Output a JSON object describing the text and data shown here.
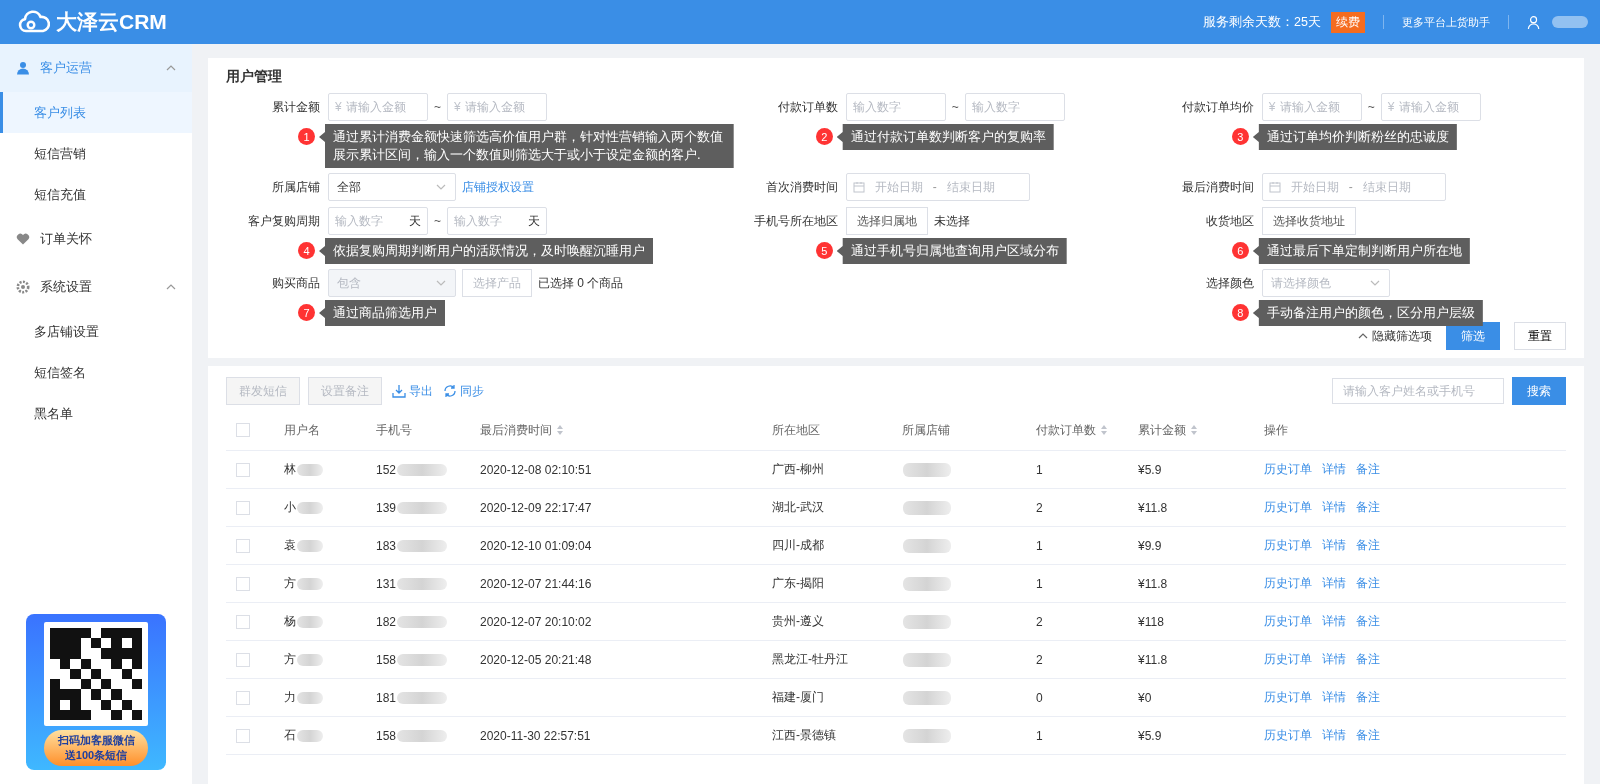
{
  "header": {
    "brand": "大泽云CRM",
    "service_days": "服务剩余天数：25天",
    "renew_badge": "续费",
    "more_link": "更多平台上货助手"
  },
  "sidebar": {
    "groups": [
      {
        "label": "客户运营",
        "selected": true,
        "expanded": true,
        "children": [
          {
            "label": "客户列表",
            "selected": true
          },
          {
            "label": "短信营销",
            "selected": false
          },
          {
            "label": "短信充值",
            "selected": false
          }
        ]
      },
      {
        "label": "订单关怀",
        "selected": false
      },
      {
        "label": "系统设置",
        "selected": false,
        "expanded": true,
        "children": [
          {
            "label": "多店铺设置",
            "selected": false
          },
          {
            "label": "短信签名",
            "selected": false
          },
          {
            "label": "黑名单",
            "selected": false
          }
        ]
      }
    ],
    "promo": {
      "lines": [
        "扫码加客服微信",
        "送**100**条短信"
      ]
    }
  },
  "filters": {
    "title": "用户管理",
    "rows": [
      {
        "cells": [
          {
            "kind": "money_range",
            "label": "累计金额",
            "prefix": "¥",
            "placeholders": [
              "请输入金额",
              "请输入金额"
            ],
            "separator": "~",
            "callout": {
              "number": "1",
              "text": "通过累计消费金额快速筛选高价值用户群，针对性营销输入两个数值展示累计区间，输入一个数值则筛选大于或小于设定金额的客户."
            }
          },
          {
            "kind": "number_range",
            "label": "付款订单数",
            "placeholders": [
              "输入数字",
              "输入数字"
            ],
            "separator": "~",
            "callout": {
              "number": "2",
              "text": "通过付款订单数判断客户的复购率"
            }
          },
          {
            "kind": "money_range",
            "label": "付款订单均价",
            "prefix": "¥",
            "placeholders": [
              "请输入金额",
              "请输入金额"
            ],
            "separator": "~",
            "callout": {
              "number": "3",
              "text": "通过订单均价判断粉丝的忠诚度"
            }
          }
        ]
      },
      {
        "cells": [
          {
            "kind": "select",
            "label": "所属店铺",
            "value": "全部",
            "disabled": false,
            "link": "店铺授权设置"
          },
          {
            "kind": "date_range",
            "label": "首次消费时间",
            "placeholders": [
              "开始日期",
              "结束日期"
            ],
            "separator": "-"
          },
          {
            "kind": "date_range",
            "label": "最后消费时间",
            "placeholders": [
              "开始日期",
              "结束日期"
            ],
            "separator": "-"
          }
        ]
      },
      {
        "cells": [
          {
            "kind": "number_range",
            "label": "客户复购周期",
            "placeholders": [
              "输入数字",
              "输入数字"
            ],
            "units": [
              "天",
              "天"
            ],
            "separator": "~",
            "callout": {
              "number": "4",
              "text": "依据复购周期判断用户的活跃情况，及时唤醒沉睡用户"
            }
          },
          {
            "kind": "picker",
            "label": "手机号所在地区",
            "button": "选择归属地",
            "note": "未选择",
            "callout": {
              "number": "5",
              "text": "通过手机号归属地查询用户区域分布"
            }
          },
          {
            "kind": "picker",
            "label": "收货地区",
            "button": "选择收货地址",
            "callout": {
              "number": "6",
              "text": "通过最后下单定制判断用户所在地"
            }
          }
        ]
      },
      {
        "cells": [
          {
            "kind": "select",
            "label": "购买商品",
            "value": "包含",
            "disabled": true,
            "button": "选择产品",
            "note": "已选择 0 个商品",
            "callout": {
              "number": "7",
              "text": "通过商品筛选用户"
            }
          },
          null,
          {
            "kind": "select",
            "label": "选择颜色",
            "placeholder": "请选择颜色",
            "disabled": false,
            "callout": {
              "number": "8",
              "text": "手动备注用户的颜色，区分用户层级"
            }
          }
        ]
      }
    ],
    "actions": {
      "toggle": "隐藏筛选项",
      "submit": "筛选",
      "reset": "重置"
    }
  },
  "toolbar": {
    "buttons": [
      {
        "label": "群发短信",
        "disabled": true
      },
      {
        "label": "设置备注",
        "disabled": true
      }
    ],
    "links": [
      {
        "label": "导出",
        "kind": "export"
      },
      {
        "label": "同步",
        "kind": "sync"
      }
    ],
    "search": {
      "placeholder": "请输入客户姓名或手机号"
    },
    "search_button": "搜索"
  },
  "table": {
    "all_checked": false,
    "columns": [
      {
        "label": "用户名",
        "sortable": false
      },
      {
        "label": "手机号",
        "sortable": false
      },
      {
        "label": "最后消费时间",
        "sortable": true
      },
      {
        "label": "所在地区",
        "sortable": false
      },
      {
        "label": "所属店铺",
        "sortable": false
      },
      {
        "label": "付款订单数",
        "sortable": true
      },
      {
        "label": "累计金额",
        "sortable": true
      },
      {
        "label": "操作",
        "sortable": false
      }
    ],
    "rows": [
      {
        "checked": false,
        "name": "林",
        "phone": "152",
        "last_time": "2020-12-08 02:10:51",
        "region": "广西-柳州",
        "orders": "1",
        "amount": "¥5.9",
        "actions": [
          "历史订单",
          "详情",
          "备注"
        ]
      },
      {
        "checked": false,
        "name": "小",
        "phone": "139",
        "last_time": "2020-12-09 22:17:47",
        "region": "湖北-武汉",
        "orders": "2",
        "amount": "¥11.8",
        "actions": [
          "历史订单",
          "详情",
          "备注"
        ]
      },
      {
        "checked": false,
        "name": "袁",
        "phone": "183",
        "last_time": "2020-12-10 01:09:04",
        "region": "四川-成都",
        "orders": "1",
        "amount": "¥9.9",
        "actions": [
          "历史订单",
          "详情",
          "备注"
        ]
      },
      {
        "checked": false,
        "name": "方",
        "phone": "131",
        "last_time": "2020-12-07 21:44:16",
        "region": "广东-揭阳",
        "orders": "1",
        "amount": "¥11.8",
        "actions": [
          "历史订单",
          "详情",
          "备注"
        ]
      },
      {
        "checked": false,
        "name": "杨",
        "phone": "182",
        "last_time": "2020-12-07 20:10:02",
        "region": "贵州-遵义",
        "orders": "2",
        "amount": "¥118",
        "actions": [
          "历史订单",
          "详情",
          "备注"
        ]
      },
      {
        "checked": false,
        "name": "方",
        "phone": "158",
        "last_time": "2020-12-05 20:21:48",
        "region": "黑龙江-牡丹江",
        "orders": "2",
        "amount": "¥11.8",
        "actions": [
          "历史订单",
          "详情",
          "备注"
        ]
      },
      {
        "checked": false,
        "name": "力",
        "phone": "181",
        "region": "福建-厦门",
        "orders": "0",
        "amount": "¥0",
        "actions": [
          "历史订单",
          "详情",
          "备注"
        ]
      },
      {
        "checked": false,
        "name": "石",
        "phone": "158",
        "last_time": "2020-11-30 22:57:51",
        "region": "江西-景德镇",
        "orders": "1",
        "amount": "¥5.9",
        "actions": [
          "历史订单",
          "详情",
          "备注"
        ]
      }
    ]
  }
}
